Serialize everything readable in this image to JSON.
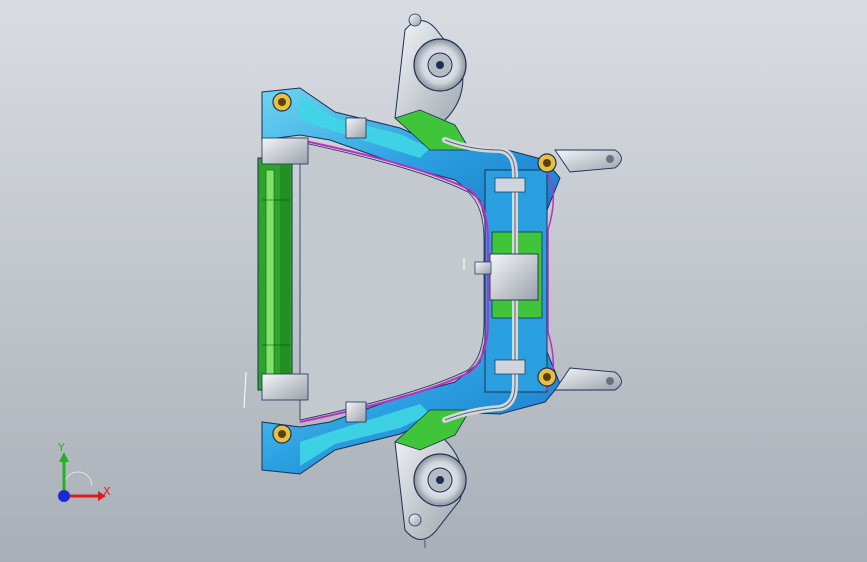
{
  "viewport": {
    "background_top": "#d9dde2",
    "background_bottom": "#a9afb7"
  },
  "model": {
    "icon": "subframe-assembly-3d-model",
    "colors": {
      "frame_blue": "#2a9fe0",
      "frame_cyan": "#3fd6e6",
      "bracket_green": "#3fc43a",
      "rail_green": "#2ea52a",
      "edge_magenta": "#c02cc8",
      "steel_gray": "#c9ced4",
      "edge_dark": "#1d2f55"
    }
  },
  "triad": {
    "x_label": "X",
    "y_label": "Y",
    "x_color": "#e01a1a",
    "y_color": "#24b024",
    "z_color": "#1a2bd6"
  }
}
